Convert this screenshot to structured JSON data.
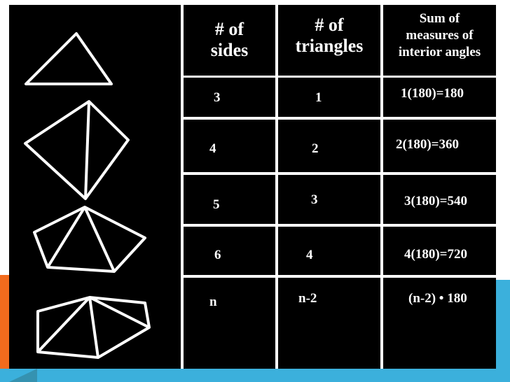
{
  "table": {
    "headers": {
      "sides": [
        "# of",
        "sides"
      ],
      "triangles": [
        "# of",
        "triangles"
      ],
      "sum": [
        "Sum of",
        "measures of",
        "interior angles"
      ]
    },
    "rows": [
      {
        "polygon": "triangle-shape",
        "sides": "3",
        "triangles": "1",
        "sum": "1(180)=180"
      },
      {
        "polygon": "quadrilateral-shape",
        "sides": "4",
        "triangles": "2",
        "sum": "2(180)=360"
      },
      {
        "polygon": "pentagon-shape",
        "sides": "5",
        "triangles": "3",
        "sum": "3(180)=540"
      },
      {
        "polygon": "hexagon-shape",
        "sides": "6",
        "triangles": "4",
        "sum": "4(180)=720"
      },
      {
        "polygon": "",
        "sides": "n",
        "triangles": "n-2",
        "sum": "(n-2) • 180"
      }
    ]
  },
  "theme": {
    "cell_bg": "#000000",
    "text_color": "#ffffff",
    "accent_orange": "#f26b1d",
    "accent_blue": "#3bb0dc"
  }
}
